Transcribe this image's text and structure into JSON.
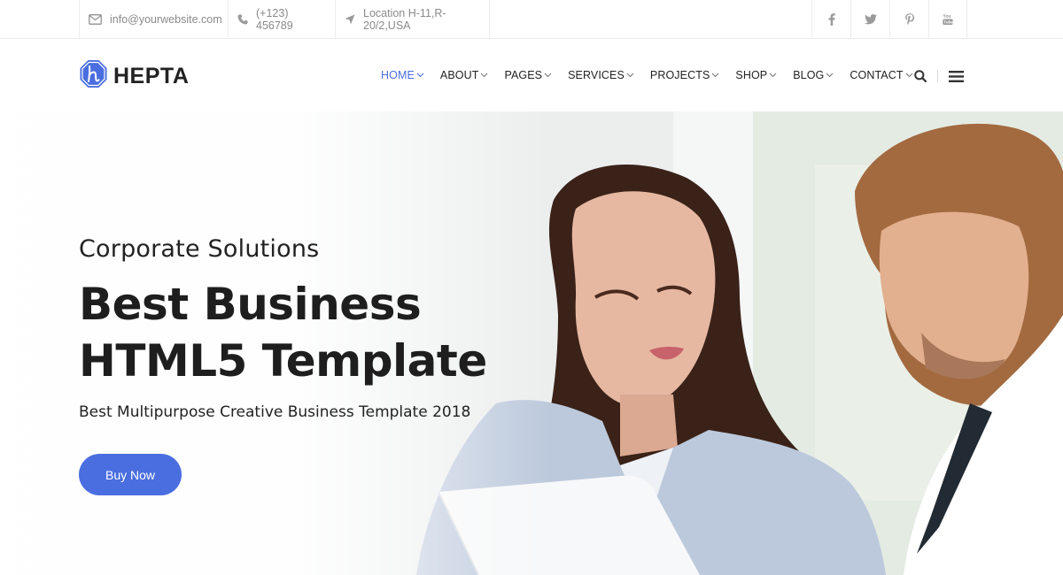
{
  "topbar": {
    "email": "info@yourwebsite.com",
    "phone": "(+123) 456789",
    "location": "Location H-11,R-20/2,USA",
    "social": [
      {
        "icon": "facebook-icon",
        "glyph": "f"
      },
      {
        "icon": "twitter-icon",
        "glyph": "t"
      },
      {
        "icon": "pinterest-icon",
        "glyph": "p"
      },
      {
        "icon": "youtube-icon",
        "glyph": "yt"
      }
    ]
  },
  "header": {
    "logo_text": "HEPTA",
    "nav": [
      {
        "label": "HOME",
        "active": true
      },
      {
        "label": "ABOUT",
        "active": false
      },
      {
        "label": "PAGES",
        "active": false
      },
      {
        "label": "SERVICES",
        "active": false
      },
      {
        "label": "PROJECTS",
        "active": false
      },
      {
        "label": "SHOP",
        "active": false
      },
      {
        "label": "BLOG",
        "active": false
      },
      {
        "label": "CONTACT",
        "active": false
      }
    ]
  },
  "hero": {
    "subtitle": "Corporate Solutions",
    "title_line1": "Best Business",
    "title_line2": "HTML5 Template",
    "description": "Best Multipurpose Creative Business Template 2018",
    "cta_label": "Buy Now"
  },
  "colors": {
    "accent": "#4a6ee0",
    "text_dark": "#1e1e1e",
    "text_muted": "#8a8a8a",
    "border": "#ececec"
  }
}
